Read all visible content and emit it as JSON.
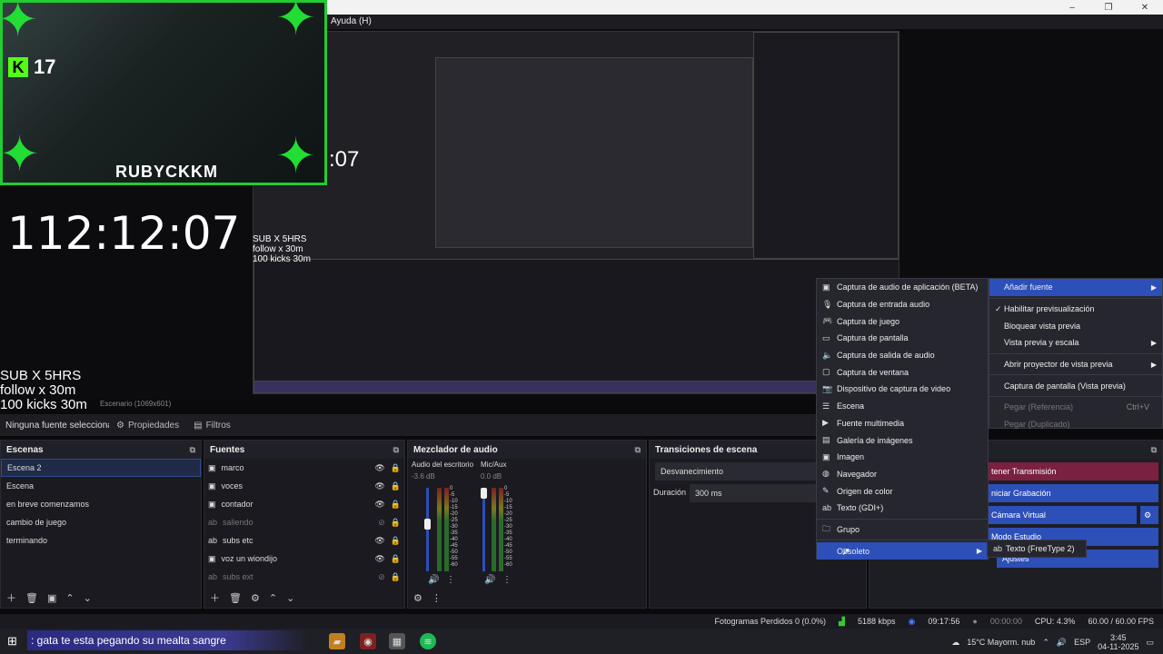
{
  "menubar": {
    "help": "Ayuda (H)"
  },
  "window": {
    "minimize": "–",
    "restore": "❐",
    "close": "✕"
  },
  "stream_overlay": {
    "kick_count": "17",
    "streamer_name": "RUBYCKKM",
    "timer": "112:12:07",
    "mini_timer": ":07",
    "lines": [
      "SUB X 5HRS",
      "follow x 30m",
      "100 kicks 30m"
    ]
  },
  "preview": {
    "label": "Escenario (1069x601)"
  },
  "context_bar": {
    "no_source": "Ninguna fuente seleccionada",
    "properties": "Propiedades",
    "filters": "Filtros"
  },
  "scenes": {
    "title": "Escenas",
    "items": [
      "Escena 2",
      "Escena",
      "en breve comenzamos",
      "cambio de juego",
      "terminando"
    ]
  },
  "sources": {
    "title": "Fuentes",
    "items": [
      {
        "label": "marco",
        "icon": "image-icon",
        "visible": true
      },
      {
        "label": "voces",
        "icon": "image-icon",
        "visible": true
      },
      {
        "label": "contador",
        "icon": "image-icon",
        "visible": true
      },
      {
        "label": "saliendo",
        "icon": "text-icon",
        "visible": false
      },
      {
        "label": "subs etc",
        "icon": "text-icon",
        "visible": true
      },
      {
        "label": "voz un wiondijo",
        "icon": "image-icon",
        "visible": true
      },
      {
        "label": "subs ext",
        "icon": "text-icon",
        "visible": false
      }
    ]
  },
  "mixer": {
    "title": "Mezclador de audio",
    "channels": [
      {
        "name": "Audio del escritorio",
        "db": "-3.6 dB"
      },
      {
        "name": "Mic/Aux",
        "db": "0.0 dB"
      }
    ],
    "scale": [
      "0",
      "-5",
      "-10",
      "-15",
      "-20",
      "-25",
      "-30",
      "-35",
      "-40",
      "-45",
      "-50",
      "-55",
      "-60"
    ]
  },
  "transitions": {
    "title": "Transiciones de escena",
    "selected": "Desvanecimiento",
    "duration_label": "Duración",
    "duration_value": "300 ms"
  },
  "controls": {
    "stop_stream": "tener Transmisión",
    "start_recording": "niciar Grabación",
    "virtual_cam": "Cámara Virtual",
    "studio_mode": "Modo Estudio",
    "settings": "Ajustes"
  },
  "context_menu": {
    "items": [
      {
        "label": "Añadir fuente",
        "submenu": true,
        "highlight": true
      },
      {
        "label": "Habilitar previsualización",
        "check": true
      },
      {
        "label": "Bloquear vista previa"
      },
      {
        "label": "Vista previa y escala",
        "submenu": true
      },
      {
        "label": "Abrir proyector de vista previa",
        "submenu": true
      },
      {
        "label": "Captura de pantalla (Vista previa)"
      },
      {
        "label": "Pegar (Referencia)",
        "shortcut": "Ctrl+V",
        "disabled": true
      },
      {
        "label": "Pegar (Duplicado)",
        "disabled": true
      }
    ]
  },
  "add_source_menu": {
    "items": [
      {
        "label": "Captura de audio de aplicación (BETA)",
        "icon": "app-audio-icon"
      },
      {
        "label": "Captura de entrada audio",
        "icon": "mic-icon"
      },
      {
        "label": "Captura de juego",
        "icon": "gamepad-icon"
      },
      {
        "label": "Captura de pantalla",
        "icon": "monitor-icon"
      },
      {
        "label": "Captura de salida de audio",
        "icon": "speaker-icon"
      },
      {
        "label": "Captura de ventana",
        "icon": "window-icon"
      },
      {
        "label": "Dispositivo de captura de video",
        "icon": "camera-icon"
      },
      {
        "label": "Escena",
        "icon": "list-icon"
      },
      {
        "label": "Fuente multimedia",
        "icon": "play-icon"
      },
      {
        "label": "Galería de imágenes",
        "icon": "images-icon"
      },
      {
        "label": "Imagen",
        "icon": "image-icon"
      },
      {
        "label": "Navegador",
        "icon": "globe-icon"
      },
      {
        "label": "Origen de color",
        "icon": "brush-icon"
      },
      {
        "label": "Texto (GDI+)",
        "icon": "text-icon"
      },
      {
        "label": "Grupo",
        "icon": "folder-icon"
      },
      {
        "label": "Obsoleto",
        "icon": "",
        "submenu": true,
        "highlight": true
      }
    ]
  },
  "obsolete_menu": {
    "items": [
      "Texto (FreeType 2)"
    ]
  },
  "statusbar": {
    "dropped": "Fotogramas Perdidos 0 (0.0%)",
    "bitrate": "5188 kbps",
    "stream_time": "09:17:56",
    "rec_time": "00:00:00",
    "cpu": "CPU: 4.3%",
    "fps": "60.00 / 60.00 FPS"
  },
  "taskbar": {
    "chat": ": gata te esta pegando su mealta sangre",
    "weather": "15°C  Mayorm. nub",
    "lang": "ESP",
    "time": "3:45",
    "date": "04-11-2025"
  },
  "colors": {
    "accent": "#2d4fb8",
    "kick_green": "#53fc18",
    "leaf_green": "#22dd33"
  }
}
